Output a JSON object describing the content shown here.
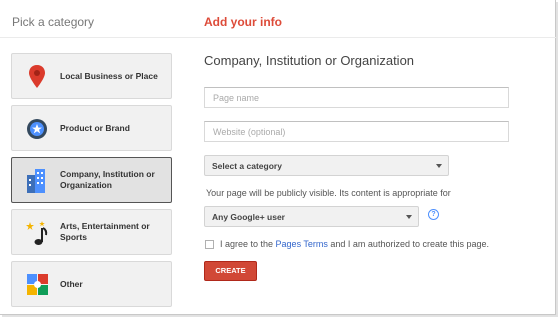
{
  "header": {
    "left_title": "Pick a category",
    "right_title": "Add your info"
  },
  "categories": [
    {
      "label": "Local Business or Place",
      "icon": "map-pin-icon",
      "selected": false
    },
    {
      "label": "Product or Brand",
      "icon": "product-badge-icon",
      "selected": false
    },
    {
      "label": "Company, Institution or Organization",
      "icon": "building-icon",
      "selected": true
    },
    {
      "label": "Arts, Entertainment or Sports",
      "icon": "music-note-icon",
      "selected": false
    },
    {
      "label": "Other",
      "icon": "squares-icon",
      "selected": false
    }
  ],
  "form": {
    "title": "Company, Institution or Organization",
    "page_name_placeholder": "Page name",
    "page_name_value": "",
    "website_placeholder": "Website (optional)",
    "website_value": "",
    "category_select": "Select a category",
    "visibility_note": "Your page will be publicly visible. Its content is appropriate for",
    "audience_select": "Any Google+ user",
    "help_glyph": "?",
    "agree_prefix": "I agree to the ",
    "agree_link": "Pages Terms",
    "agree_suffix": " and I am authorized to create this page.",
    "agree_checked": false,
    "create_label": "CREATE"
  },
  "colors": {
    "accent_red": "#dd4b39",
    "create_button": "#d14836",
    "link_blue": "#3366cc",
    "help_blue": "#4d90fe"
  }
}
